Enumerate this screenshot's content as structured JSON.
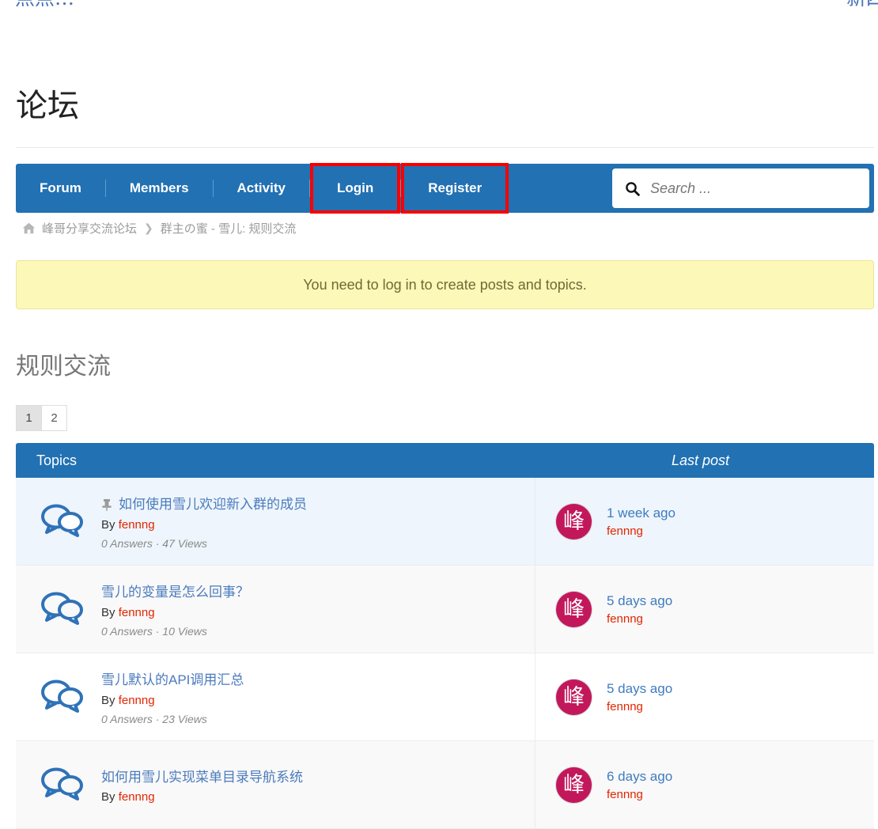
{
  "cut_top": {
    "left_text": "一点点…",
    "right_text": "新四"
  },
  "page_title": "论坛",
  "nav": {
    "items": [
      {
        "label": "Forum",
        "highlighted": false
      },
      {
        "label": "Members",
        "highlighted": false
      },
      {
        "label": "Activity",
        "highlighted": false
      },
      {
        "label": "Login",
        "highlighted": true
      },
      {
        "label": "Register",
        "highlighted": true
      }
    ],
    "highlight_color": "#f80000",
    "bar_color": "#2271b3"
  },
  "search": {
    "placeholder": "Search ...",
    "value": "",
    "icon": "search-icon"
  },
  "breadcrumb": {
    "home_icon": "home-icon",
    "items": [
      "峰哥分享交流论坛",
      "群主の蜜 - 雪儿: 规则交流"
    ],
    "separator": "❯"
  },
  "notice": {
    "text": "You need to log in to create posts and topics.",
    "background": "#fcf8b8"
  },
  "section": {
    "heading": "规则交流"
  },
  "pagination": {
    "pages": [
      {
        "label": "1",
        "active": true
      },
      {
        "label": "2",
        "active": false
      }
    ]
  },
  "table": {
    "headers": {
      "topics": "Topics",
      "last_post": "Last post"
    },
    "rows": [
      {
        "title": "如何使用雪儿欢迎新入群的成员",
        "pinned": true,
        "by_prefix": "By",
        "author": "fennng",
        "meta": "0 Answers · 47 Views",
        "answers": 0,
        "views": 47,
        "last_time": "1 week ago",
        "last_author": "fennng",
        "avatar_char": "峰",
        "style": "sticky"
      },
      {
        "title": "雪儿的变量是怎么回事？",
        "pinned": false,
        "by_prefix": "By",
        "author": "fennng",
        "meta": "0 Answers · 10 Views",
        "answers": 0,
        "views": 10,
        "last_time": "5 days ago",
        "last_author": "fennng",
        "avatar_char": "峰",
        "style": "alt"
      },
      {
        "title": "雪儿默认的API调用汇总",
        "pinned": false,
        "by_prefix": "By",
        "author": "fennng",
        "meta": "0 Answers · 23 Views",
        "answers": 0,
        "views": 23,
        "last_time": "5 days ago",
        "last_author": "fennng",
        "avatar_char": "峰",
        "style": "plain"
      },
      {
        "title": "如何用雪儿实现菜单目录导航系统",
        "pinned": false,
        "by_prefix": "By",
        "author": "fennng",
        "meta": "",
        "last_time": "6 days ago",
        "last_author": "fennng",
        "avatar_char": "峰",
        "style": "alt"
      }
    ]
  }
}
